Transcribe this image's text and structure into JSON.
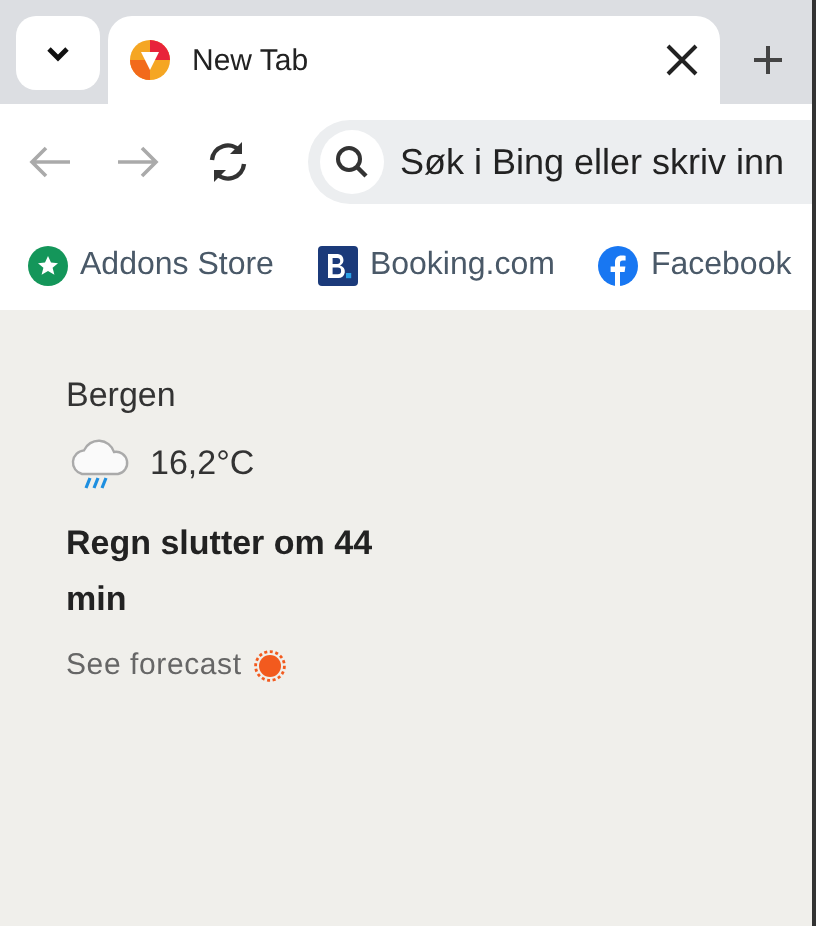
{
  "tab_strip": {
    "tabs": [
      {
        "title": "New Tab",
        "selected": true
      }
    ]
  },
  "toolbar": {
    "back_disabled": true,
    "forward_disabled": true,
    "search": {
      "placeholder": "Søk i Bing eller skriv inn"
    }
  },
  "bookmarks": [
    {
      "label": "Addons Store",
      "kind": "store"
    },
    {
      "label": "Booking.com",
      "kind": "booking"
    },
    {
      "label": "Facebook",
      "kind": "facebook"
    }
  ],
  "weather": {
    "city": "Bergen",
    "temperature": "16,2°C",
    "summary": "Regn slutter om 44 min",
    "link": "See forecast"
  }
}
